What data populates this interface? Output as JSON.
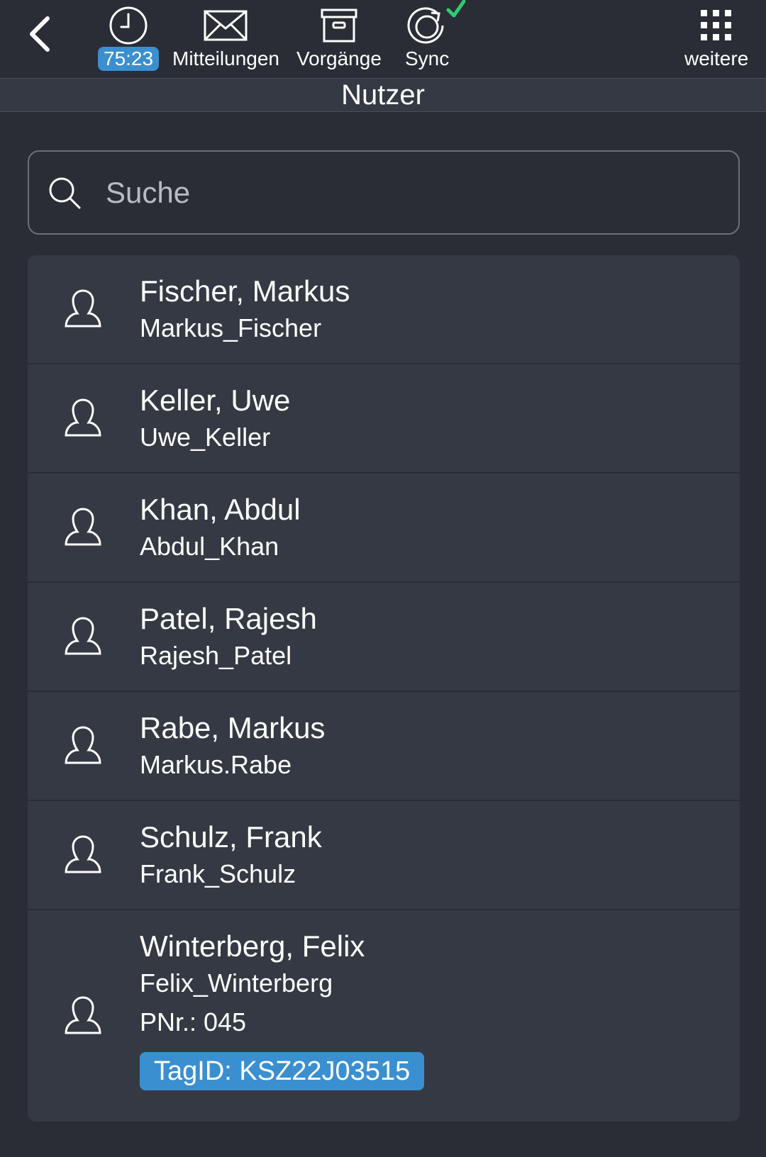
{
  "header": {
    "time_badge": "75:23",
    "messages_label": "Mitteilungen",
    "processes_label": "Vorgänge",
    "sync_label": "Sync",
    "more_label": "weitere",
    "sync_ok_color": "#2ecc71"
  },
  "page": {
    "title": "Nutzer"
  },
  "search": {
    "placeholder": "Suche",
    "value": ""
  },
  "users": [
    {
      "name": "Fischer, Markus",
      "login": "Markus_Fischer"
    },
    {
      "name": "Keller, Uwe",
      "login": "Uwe_Keller"
    },
    {
      "name": "Khan, Abdul",
      "login": "Abdul_Khan"
    },
    {
      "name": "Patel, Rajesh",
      "login": "Rajesh_Patel"
    },
    {
      "name": "Rabe, Markus",
      "login": "Markus.Rabe"
    },
    {
      "name": "Schulz, Frank",
      "login": "Frank_Schulz"
    },
    {
      "name": "Winterberg, Felix",
      "login": "Felix_Winterberg",
      "pnr": "PNr.: 045",
      "tag": "TagID: KSZ22J03515"
    }
  ],
  "colors": {
    "accent": "#3a8fd0",
    "background": "#2a2d35",
    "row": "#353943"
  }
}
